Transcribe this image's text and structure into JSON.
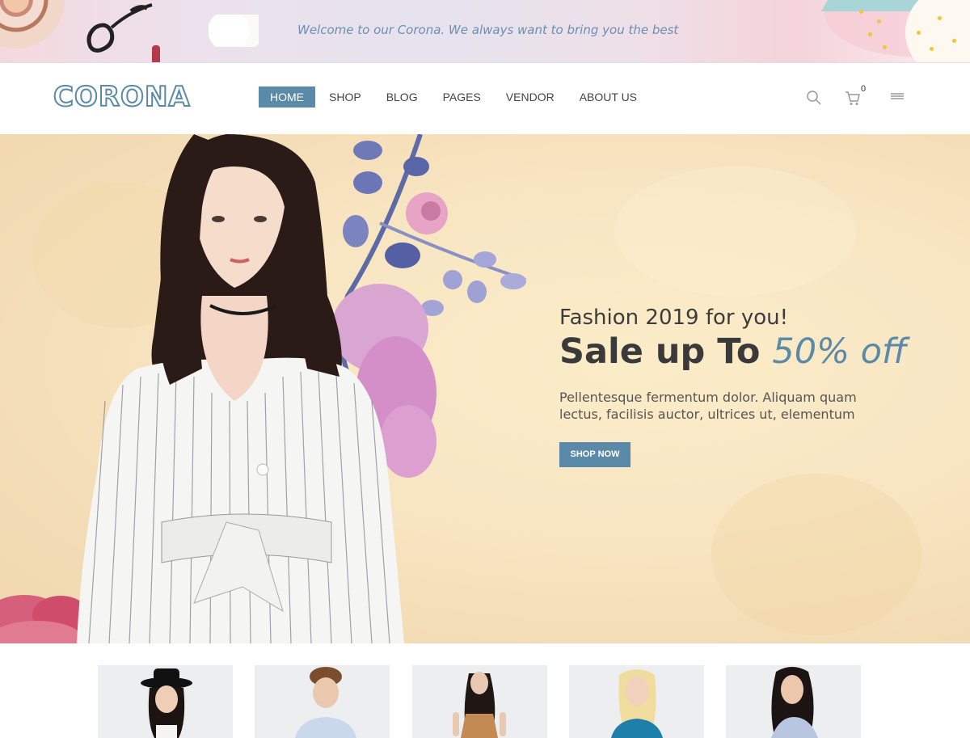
{
  "promo": {
    "text": "Welcome to our Corona. We always want to bring you the best"
  },
  "header": {
    "logo": "CORONA",
    "nav": [
      {
        "label": "HOME",
        "active": true
      },
      {
        "label": "SHOP",
        "active": false
      },
      {
        "label": "BLOG",
        "active": false
      },
      {
        "label": "PAGES",
        "active": false
      },
      {
        "label": "VENDOR",
        "active": false
      },
      {
        "label": "ABOUT US",
        "active": false
      }
    ],
    "cart_count": "0",
    "icons": [
      "search-icon",
      "cart-icon",
      "menu-icon"
    ]
  },
  "hero": {
    "subtitle": "Fashion 2019 for you!",
    "title_main": "Sale up To ",
    "title_accent": "50% off",
    "description": "Pellentesque fermentum dolor. Aliquam quam lectus, facilisis auctor, ultrices ut, elementum",
    "button": "SHOP NOW"
  },
  "categories": [
    {
      "name": "woman-hat"
    },
    {
      "name": "man-shirt"
    },
    {
      "name": "woman-top"
    },
    {
      "name": "woman-blonde"
    },
    {
      "name": "woman-lace"
    }
  ],
  "colors": {
    "accent": "#5b8aa8",
    "text_dark": "#3a3a3a",
    "promo_text": "#6a8fb2"
  }
}
